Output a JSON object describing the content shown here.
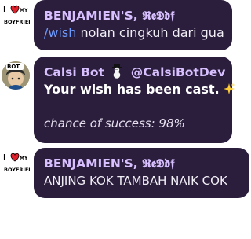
{
  "messages": [
    {
      "author": "BENJAMIEN'S, 𝕽𝖊𝕯𝖉𝖋",
      "avatar_icon": "heart-boyfriend-avatar",
      "command": "/wish",
      "text": " nolan cingkuh dari gua"
    },
    {
      "author_name": "Calsi Bot",
      "author_handle": "@CalsiBotDev",
      "avatar_icon": "calsi-bot-avatar",
      "avatar_badge": "BOT",
      "line1": "Your wish has been cast.",
      "line2": "chance of success: 98%"
    },
    {
      "author": "BENJAMIEN'S, 𝕽𝖊𝕯𝖉𝖋",
      "avatar_icon": "heart-boyfriend-avatar",
      "text": "ANJING KOK TAMBAH NAIK COK"
    }
  ],
  "colors": {
    "bubble": "#2b1e3d",
    "author": "#d8c0ff",
    "command": "#6d9bff"
  }
}
